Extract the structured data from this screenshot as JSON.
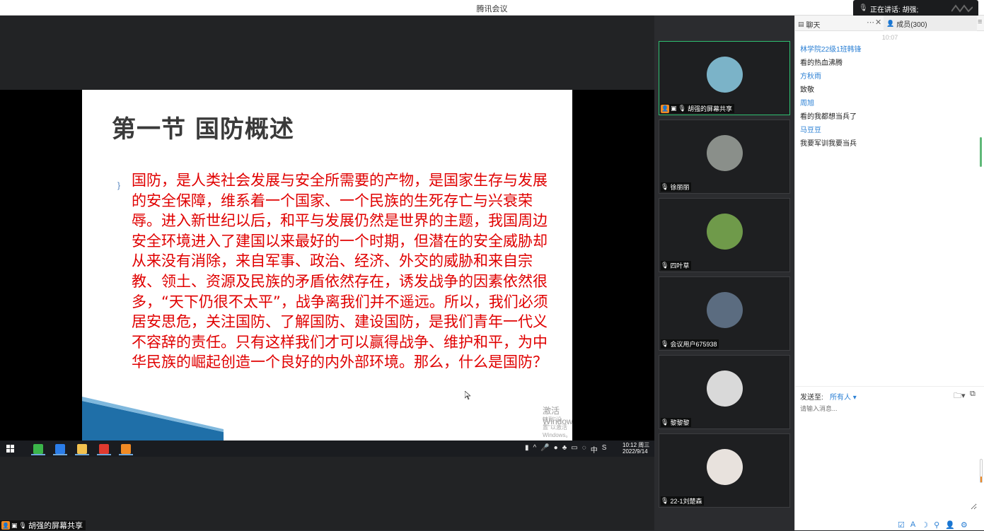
{
  "window": {
    "title": "腾讯会议"
  },
  "speaking": {
    "label": "正在讲话: 胡强;"
  },
  "slide": {
    "title": "第一节 国防概述",
    "bullet": "}",
    "body": "国防，是人类社会发展与安全所需要的产物，是国家生存与发展的安全保障，维系着一个国家、一个民族的生死存亡与兴衰荣辱。进入新世纪以后，和平与发展仍然是世界的主题，我国周边安全环境进入了建国以来最好的一个时期，但潜在的安全威胁却从来没有消除，来自军事、政治、经济、外交的威胁和来自宗教、领土、资源及民族的矛盾依然存在，诱发战争的因素依然很多，“天下仍很不太平”，战争离我们并不遥远。所以，我们必须居安思危，关注国防、了解国防、建设国防，是我们青年一代义不容辞的责任。只有这样我们才可以赢得战争、维护和平，为中华民族的崛起创造一个良好的内外部环境。那么，什么是国防？",
    "activation_title": "激活 Windows",
    "activation_sub": "转到\"设置\"以激活 Windows。"
  },
  "taskbar": {
    "apps": [
      {
        "name": "browser-app",
        "color": "#3bb54a"
      },
      {
        "name": "photos-app",
        "color": "#2b7de9"
      },
      {
        "name": "explorer-app",
        "color": "#f2c14e"
      },
      {
        "name": "wps-app",
        "color": "#e03a2f"
      },
      {
        "name": "media-app",
        "color": "#f08a24"
      }
    ],
    "tray_symbols": [
      "▮",
      "^",
      "🎤",
      "●",
      "♣",
      "▭",
      "◌",
      "中",
      "S"
    ],
    "time": "10:12 周三",
    "date": "2022/9/14"
  },
  "share_label": {
    "text": "胡强的屏幕共享"
  },
  "participants": [
    {
      "name": "胡强的屏幕共享",
      "avatar_bg": "#7bb3c8",
      "active": true
    },
    {
      "name": "徐丽丽",
      "avatar_bg": "#8a8f8a",
      "active": false
    },
    {
      "name": "四叶草",
      "avatar_bg": "#6f9a4a",
      "active": false
    },
    {
      "name": "会议用户675938",
      "avatar_bg": "#5b6c80",
      "active": false
    },
    {
      "name": "黎黎黎",
      "avatar_bg": "#d9d9d9",
      "active": false
    },
    {
      "name": "22-1刘楚森",
      "avatar_bg": "#e8e2dd",
      "active": false
    }
  ],
  "chat": {
    "tab_chat": "聊天",
    "tab_members": "成员(300)",
    "more": "⋯",
    "close": "✕",
    "menu": "≡",
    "time": "10:07",
    "messages": [
      {
        "sender": "林学院22级1班韩锋",
        "text": "看的热血沸腾"
      },
      {
        "sender": "方秋雨",
        "text": "致敬"
      },
      {
        "sender": "周旭",
        "text": "看的我都想当兵了"
      },
      {
        "sender": "马豆豆",
        "text": "我要军训我要当兵"
      }
    ],
    "send_to_label": "发送至:",
    "send_to_target": "所有人 ▾",
    "input_placeholder": "请输入消息..."
  },
  "colors": {
    "accent": "#2a7fd4",
    "active_border": "#2fbf71",
    "slide_text": "#e00000",
    "orange": "#f08a24"
  }
}
